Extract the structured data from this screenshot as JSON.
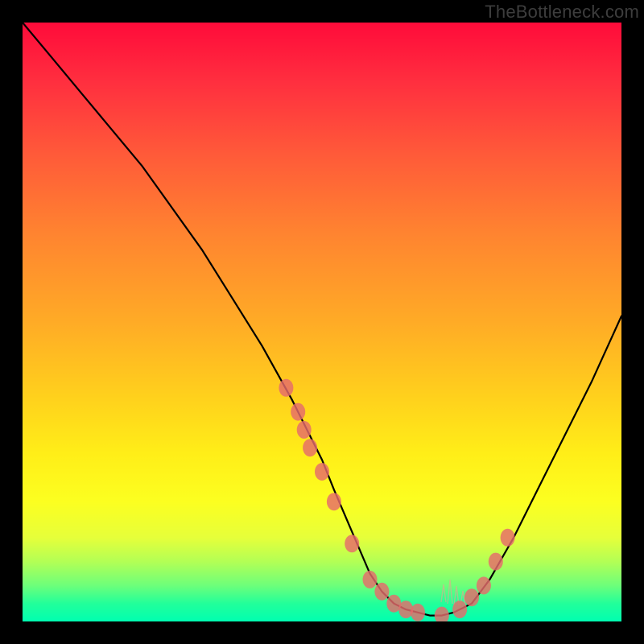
{
  "watermark": "TheBottleneck.com",
  "colors": {
    "page_bg": "#000000",
    "curve": "#000000",
    "marker": "#e56b6b",
    "jitter": "#f59a8f",
    "gradient_top": "#ff0b3a",
    "gradient_bottom": "#00ffb0"
  },
  "chart_data": {
    "type": "line",
    "title": "",
    "xlabel": "",
    "ylabel": "",
    "xlim": [
      0,
      100
    ],
    "ylim": [
      0,
      100
    ],
    "grid": false,
    "legend_position": "none",
    "annotations": [
      "TheBottleneck.com"
    ],
    "series": [
      {
        "name": "curve",
        "x": [
          0,
          5,
          10,
          15,
          20,
          25,
          30,
          35,
          40,
          45,
          48,
          50,
          52,
          55,
          58,
          60,
          62,
          64,
          66,
          68,
          70,
          72,
          75,
          78,
          82,
          86,
          90,
          95,
          100
        ],
        "y": [
          100,
          94,
          88,
          82,
          76,
          69,
          62,
          54,
          46,
          37,
          31,
          27,
          22,
          15,
          8,
          5,
          3,
          2,
          1.5,
          1,
          1,
          1.5,
          3,
          7,
          14,
          22,
          30,
          40,
          51
        ]
      }
    ],
    "markers": {
      "name": "highlighted-points",
      "x": [
        44,
        46,
        47,
        48,
        50,
        52,
        55,
        58,
        60,
        62,
        64,
        66,
        70,
        73,
        75,
        77,
        79,
        81
      ],
      "y": [
        39,
        35,
        32,
        29,
        25,
        20,
        13,
        7,
        5,
        3,
        2,
        1.5,
        1,
        2,
        4,
        6,
        10,
        14
      ]
    }
  }
}
